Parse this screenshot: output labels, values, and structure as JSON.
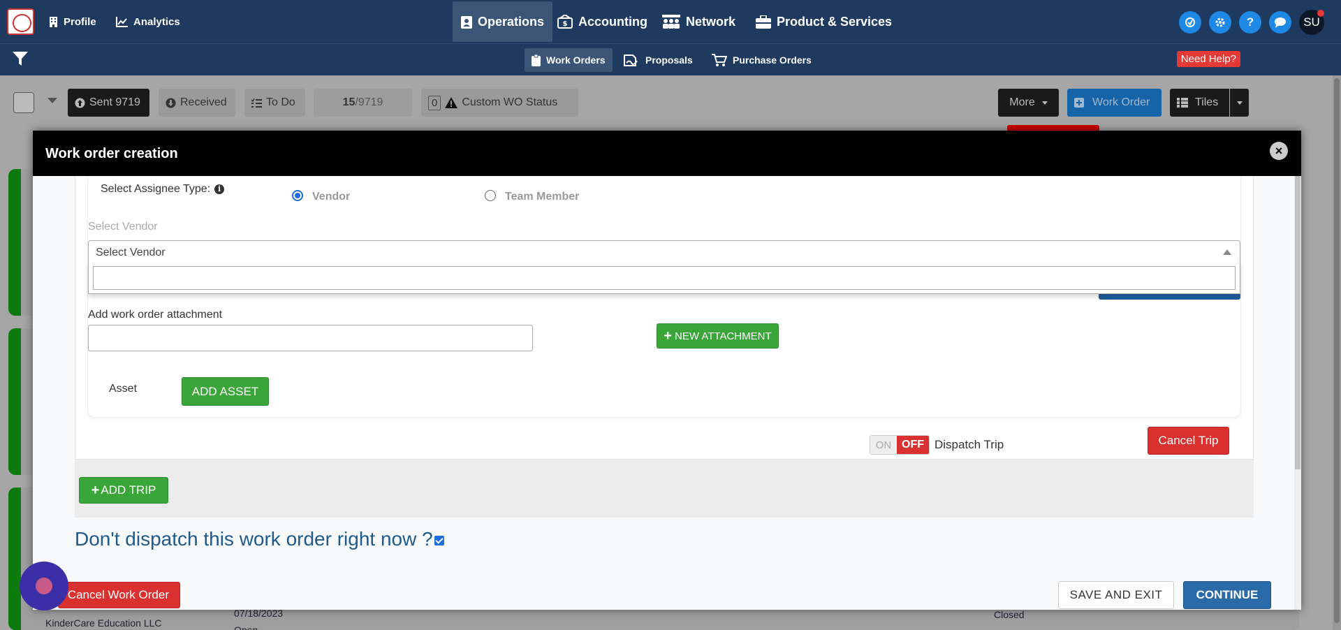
{
  "topnav": {
    "left_links": [
      {
        "label": "Profile",
        "icon": "building-icon"
      },
      {
        "label": "Analytics",
        "icon": "chart-line-icon"
      }
    ],
    "main_links": [
      {
        "label": "Operations",
        "icon": "clipboard-user-icon"
      },
      {
        "label": "Accounting",
        "icon": "money-bill-icon"
      },
      {
        "label": "Network",
        "icon": "users-network-icon"
      },
      {
        "label": "Product & Services",
        "icon": "briefcase-icon"
      }
    ],
    "avatar_initials": "SU"
  },
  "subnav": {
    "links": [
      {
        "label": "Work Orders",
        "icon": "clipboard-icon"
      },
      {
        "label": "Proposals",
        "icon": "file-signature-icon"
      },
      {
        "label": "Purchase Orders",
        "icon": "shopping-cart-icon"
      }
    ],
    "need_help": "Need Help?"
  },
  "toolbar": {
    "sent": "Sent 9719",
    "received": "Received",
    "todo": "To Do",
    "page_current": "15",
    "page_sep": " / ",
    "page_total": "9719",
    "custom_count": "0",
    "custom_status": "Custom WO Status",
    "more": "More",
    "work_order": "Work Order",
    "tiles": "Tiles"
  },
  "background": {
    "date": "07/18/2023",
    "status_open": "Open",
    "status_closed": "Closed",
    "company": "KinderCare Education LLC"
  },
  "modal": {
    "title": "Work order creation",
    "assignee_type_label": "Select Assignee Type:",
    "vendor_option": "Vendor",
    "team_member_option": "Team Member",
    "select_vendor_label": "Select Vendor",
    "select_vendor_value": "Select Vendor",
    "search_value": "",
    "attachment_label": "Add work order attachment",
    "new_attachment": "NEW ATTACHMENT",
    "asset_label": "Asset",
    "add_asset": "ADD ASSET",
    "toggle_on": "ON",
    "toggle_off": "OFF",
    "dispatch_trip": "Dispatch Trip",
    "cancel_trip": "Cancel Trip",
    "add_trip": "ADD TRIP",
    "dont_dispatch": "Don't dispatch this work order right now ?",
    "cancel_work_order": "Cancel Work Order",
    "save_and_exit": "SAVE AND EXIT",
    "continue": "CONTINUE"
  },
  "colors": {
    "nav_bg": "#1f3a5f",
    "primary_blue": "#2b6aa8",
    "success_green": "#3aa63a",
    "danger_red": "#d9312f"
  }
}
